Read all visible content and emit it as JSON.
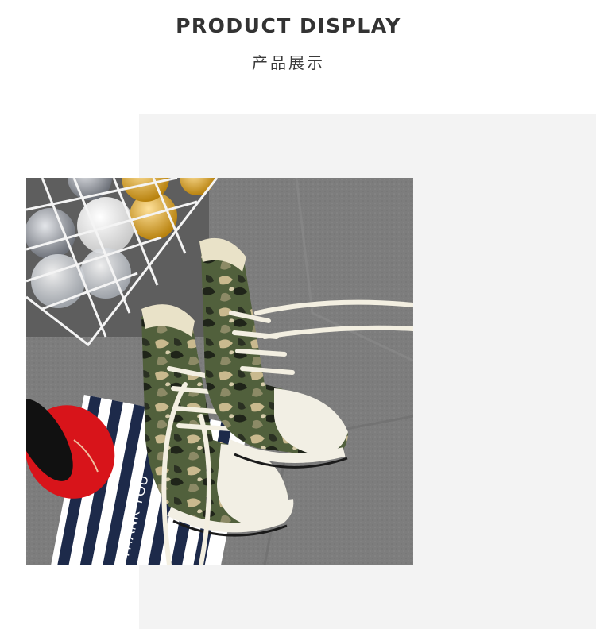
{
  "header": {
    "title": "PRODUCT DISPLAY",
    "subtitle": "产品展示"
  },
  "photo": {
    "subject": "camouflage high-top canvas sneakers",
    "card_text": "THANK YOU",
    "cup_color": "#d8141a"
  }
}
